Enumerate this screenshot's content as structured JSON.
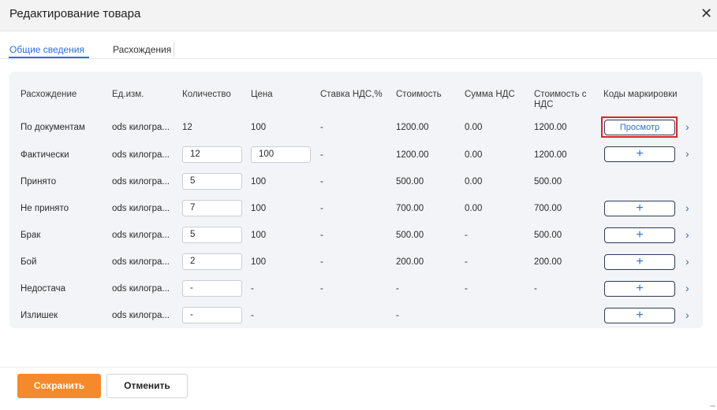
{
  "dialog": {
    "title": "Редактирование товара",
    "close_icon": "close-icon"
  },
  "tabs": [
    {
      "label": "Общие сведения"
    },
    {
      "label": "Расхождения"
    }
  ],
  "table": {
    "headers": [
      "Расхождение",
      "Ед.изм.",
      "Количество",
      "Цена",
      "Ставка НДС,%",
      "Стоимость",
      "Сумма НДС",
      "Стоимость с",
      "НДС",
      "Коды маркировки"
    ],
    "rows": [
      {
        "name": "По документам",
        "unit": "ods килогра...",
        "qty": "12",
        "price": "100",
        "vat_rate": "-",
        "cost": "1200.00",
        "vat_sum": "0.00",
        "cost_vat": "1200.00",
        "marking": "Просмотр"
      },
      {
        "name": "Фактически",
        "unit": "ods килогра...",
        "qty": "12",
        "price": "100",
        "vat_rate": "-",
        "cost": "1200.00",
        "vat_sum": "0.00",
        "cost_vat": "1200.00",
        "marking": "+"
      },
      {
        "name": "Принято",
        "unit": "ods килогра...",
        "qty": "5",
        "price": "100",
        "vat_rate": "-",
        "cost": "500.00",
        "vat_sum": "0.00",
        "cost_vat": "500.00",
        "marking": ""
      },
      {
        "name": "Не принято",
        "unit": "ods килогра...",
        "qty": "7",
        "price": "100",
        "vat_rate": "-",
        "cost": "700.00",
        "vat_sum": "0.00",
        "cost_vat": "700.00",
        "marking": "+"
      },
      {
        "name": "Брак",
        "unit": "ods килогра...",
        "qty": "5",
        "price": "100",
        "vat_rate": "-",
        "cost": "500.00",
        "vat_sum": "-",
        "cost_vat": "500.00",
        "marking": "+"
      },
      {
        "name": "Бой",
        "unit": "ods килогра...",
        "qty": "2",
        "price": "100",
        "vat_rate": "-",
        "cost": "200.00",
        "vat_sum": "-",
        "cost_vat": "200.00",
        "marking": "+"
      },
      {
        "name": "Недостача",
        "unit": "ods килогра...",
        "qty": "-",
        "price": "-",
        "vat_rate": "-",
        "cost": "-",
        "vat_sum": "-",
        "cost_vat": "-",
        "marking": "+"
      },
      {
        "name": "Излишек",
        "unit": "ods килогра...",
        "qty": "-",
        "price": "-",
        "vat_rate": "",
        "cost": "-",
        "vat_sum": "",
        "cost_vat": "",
        "marking": "+"
      }
    ],
    "chevron": "›"
  },
  "footer": {
    "save_label": "Сохранить",
    "cancel_label": "Отменить"
  },
  "colors": {
    "accent_blue": "#2a6fdb",
    "save_orange": "#f58a2c",
    "highlight_red": "#d9262a"
  }
}
